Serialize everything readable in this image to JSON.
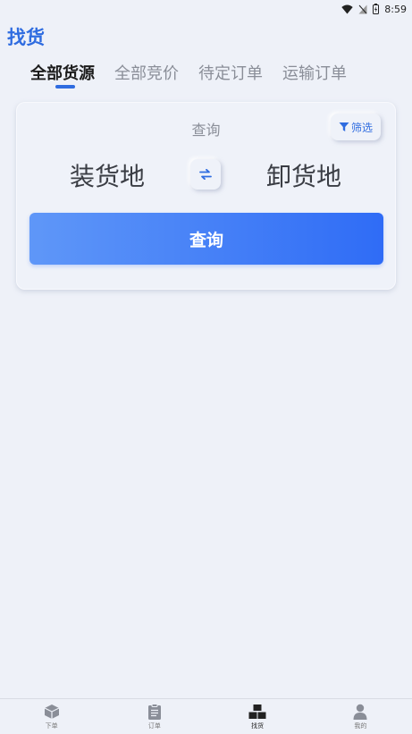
{
  "status_bar": {
    "time": "8:59"
  },
  "page": {
    "title": "找货"
  },
  "tabs": [
    {
      "label": "全部货源",
      "active": true
    },
    {
      "label": "全部竞价",
      "active": false
    },
    {
      "label": "待定订单",
      "active": false
    },
    {
      "label": "运输订单",
      "active": false
    }
  ],
  "search_card": {
    "title": "查询",
    "filter_label": "筛选",
    "origin_label": "装货地",
    "destination_label": "卸货地",
    "query_button_label": "查询"
  },
  "bottom_nav": [
    {
      "label": "下单",
      "icon": "box-icon"
    },
    {
      "label": "订单",
      "icon": "clipboard-icon"
    },
    {
      "label": "找货",
      "icon": "boxes-stack-icon",
      "active": true
    },
    {
      "label": "我的",
      "icon": "person-icon"
    }
  ],
  "colors": {
    "accent": "#2f6ce0",
    "background": "#eef1f8",
    "button_gradient_start": "#5f97f8",
    "button_gradient_end": "#2f6cf6"
  }
}
